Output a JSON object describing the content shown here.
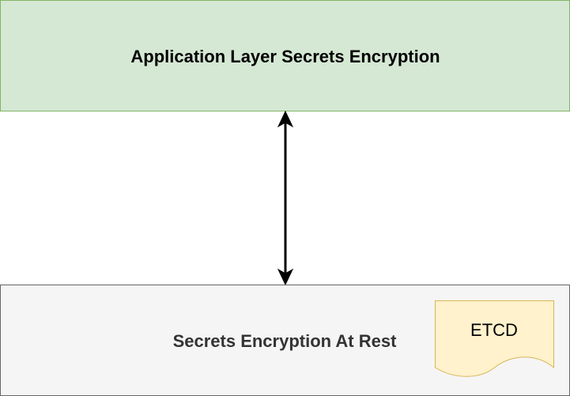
{
  "diagram": {
    "top_box": {
      "label": "Application Layer Secrets Encryption",
      "fill": "#d5e8d4",
      "stroke": "#82b366"
    },
    "bottom_box": {
      "label": "Secrets Encryption At Rest",
      "fill": "#f5f5f5",
      "stroke": "#666666"
    },
    "etcd": {
      "label": "ETCD",
      "fill": "#fff2cc",
      "stroke": "#d6b656"
    },
    "connector": {
      "type": "bidirectional-arrow",
      "color": "#000000"
    }
  }
}
